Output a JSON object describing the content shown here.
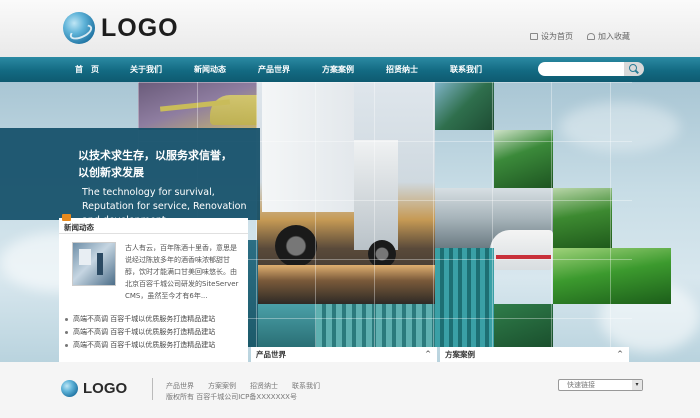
{
  "header": {
    "logo_text": "LOGO",
    "top_links": [
      "设为首页",
      "加入收藏"
    ]
  },
  "nav": {
    "items": [
      "首　页",
      "关于我们",
      "新闻动态",
      "产品世界",
      "方案案例",
      "招贤纳士",
      "联系我们"
    ]
  },
  "search": {
    "value": "",
    "placeholder": ""
  },
  "banner": {
    "slogan_cn_line1": "以技术求生存，以服务求信誉，",
    "slogan_cn_line2": "以创新求发展",
    "slogan_en": "The technology for survival, Reputation for service, Renovation and development"
  },
  "news": {
    "title": "新闻动态",
    "summary": "古人有云，百年陈酒十里香，意思是说经过陈放多年的酒香味浓郁甜甘醇，饮时才能满口甘美回味悠长。由北京百容千城公司研发的SiteServer CMS，虽然至今才有6年...",
    "items": [
      "高端不高调 百容千城以优质服务打造精品建站",
      "高端不高调 百容千城以优质服务打造精品建站",
      "高端不高调 百容千城以优质服务打造精品建站"
    ]
  },
  "tabs": {
    "products": "产品世界",
    "cases": "方案案例",
    "caret": "^"
  },
  "footer": {
    "logo_text": "LOGO",
    "links": [
      "产品世界",
      "方案案例",
      "招贤纳士",
      "联系我们"
    ],
    "copyright": "版权所有 百容千城公司ICP备XXXXXXX号",
    "quick_link": "快速链接",
    "select_arrow": "▾"
  },
  "colors": {
    "nav": "#136a82",
    "slogan_bg": "#124e68",
    "news_tag": "#e78a1e"
  }
}
